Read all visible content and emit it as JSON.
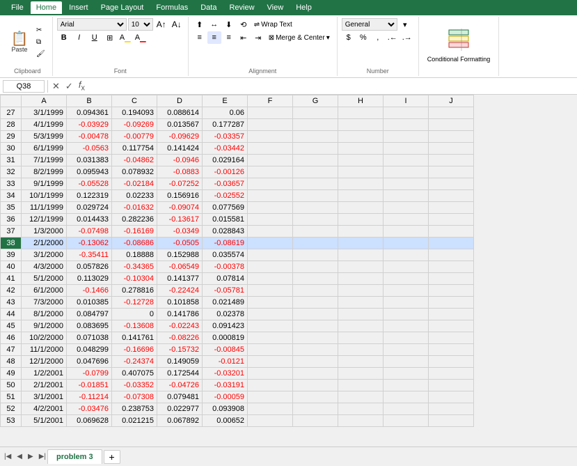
{
  "ribbon": {
    "tabs": [
      "File",
      "Home",
      "Insert",
      "Page Layout",
      "Formulas",
      "Data",
      "Review",
      "View",
      "Help"
    ],
    "active_tab": "Home",
    "groups": {
      "clipboard": {
        "label": "Clipboard",
        "paste_label": "Paste"
      },
      "font": {
        "label": "Font",
        "font_name": "Arial",
        "font_size": "10",
        "bold": "B",
        "italic": "I",
        "underline": "U"
      },
      "alignment": {
        "label": "Alignment",
        "wrap_text": "Wrap Text",
        "merge_center": "Merge & Center"
      },
      "number": {
        "label": "Number",
        "format": "General"
      },
      "conditional": {
        "label": "Conditional Formatting",
        "icon": "▤"
      }
    }
  },
  "formula_bar": {
    "cell_ref": "Q38",
    "formula": ""
  },
  "columns": [
    "",
    "A",
    "B",
    "C",
    "D",
    "E",
    "F",
    "G",
    "H",
    "I",
    "J"
  ],
  "rows": [
    {
      "num": 27,
      "a": "3/1/1999",
      "b": "0.094361",
      "c": "0.194093",
      "d": "0.088614",
      "e": "0.06"
    },
    {
      "num": 28,
      "a": "4/1/1999",
      "b": "-0.03929",
      "c": "-0.09269",
      "d": "0.013567",
      "e": "0.177287"
    },
    {
      "num": 29,
      "a": "5/3/1999",
      "b": "-0.00478",
      "c": "-0.00779",
      "d": "-0.09629",
      "e": "-0.03357"
    },
    {
      "num": 30,
      "a": "6/1/1999",
      "b": "-0.0563",
      "c": "0.117754",
      "d": "0.141424",
      "e": "-0.03442"
    },
    {
      "num": 31,
      "a": "7/1/1999",
      "b": "0.031383",
      "c": "-0.04862",
      "d": "-0.0946",
      "e": "0.029164"
    },
    {
      "num": 32,
      "a": "8/2/1999",
      "b": "0.095943",
      "c": "0.078932",
      "d": "-0.0883",
      "e": "-0.00126"
    },
    {
      "num": 33,
      "a": "9/1/1999",
      "b": "-0.05528",
      "c": "-0.02184",
      "d": "-0.07252",
      "e": "-0.03657"
    },
    {
      "num": 34,
      "a": "10/1/1999",
      "b": "0.122319",
      "c": "0.02233",
      "d": "0.156916",
      "e": "-0.02552"
    },
    {
      "num": 35,
      "a": "11/1/1999",
      "b": "0.029724",
      "c": "-0.01632",
      "d": "-0.09074",
      "e": "0.077569"
    },
    {
      "num": 36,
      "a": "12/1/1999",
      "b": "0.014433",
      "c": "0.282236",
      "d": "-0.13617",
      "e": "0.015581"
    },
    {
      "num": 37,
      "a": "1/3/2000",
      "b": "-0.07498",
      "c": "-0.16169",
      "d": "-0.0349",
      "e": "0.028843"
    },
    {
      "num": 38,
      "a": "2/1/2000",
      "b": "-0.13062",
      "c": "-0.08686",
      "d": "-0.0505",
      "e": "-0.08619",
      "selected": true
    },
    {
      "num": 39,
      "a": "3/1/2000",
      "b": "-0.35411",
      "c": "0.18888",
      "d": "0.152988",
      "e": "0.035574"
    },
    {
      "num": 40,
      "a": "4/3/2000",
      "b": "0.057826",
      "c": "-0.34365",
      "d": "-0.06549",
      "e": "-0.00378"
    },
    {
      "num": 41,
      "a": "5/1/2000",
      "b": "0.113029",
      "c": "-0.10304",
      "d": "0.141377",
      "e": "0.07814"
    },
    {
      "num": 42,
      "a": "6/1/2000",
      "b": "-0.1466",
      "c": "0.278816",
      "d": "-0.22424",
      "e": "-0.05781"
    },
    {
      "num": 43,
      "a": "7/3/2000",
      "b": "0.010385",
      "c": "-0.12728",
      "d": "0.101858",
      "e": "0.021489"
    },
    {
      "num": 44,
      "a": "8/1/2000",
      "b": "0.084797",
      "c": "0",
      "d": "0.141786",
      "e": "0.02378"
    },
    {
      "num": 45,
      "a": "9/1/2000",
      "b": "0.083695",
      "c": "-0.13608",
      "d": "-0.02243",
      "e": "0.091423"
    },
    {
      "num": 46,
      "a": "10/2/2000",
      "b": "0.071038",
      "c": "0.141761",
      "d": "-0.08226",
      "e": "0.000819"
    },
    {
      "num": 47,
      "a": "11/1/2000",
      "b": "0.048299",
      "c": "-0.16696",
      "d": "-0.15732",
      "e": "-0.00845"
    },
    {
      "num": 48,
      "a": "12/1/2000",
      "b": "0.047696",
      "c": "-0.24374",
      "d": "0.149059",
      "e": "-0.0121"
    },
    {
      "num": 49,
      "a": "1/2/2001",
      "b": "-0.0799",
      "c": "0.407075",
      "d": "0.172544",
      "e": "-0.03201"
    },
    {
      "num": 50,
      "a": "2/1/2001",
      "b": "-0.01851",
      "c": "-0.03352",
      "d": "-0.04726",
      "e": "-0.03191"
    },
    {
      "num": 51,
      "a": "3/1/2001",
      "b": "-0.11214",
      "c": "-0.07308",
      "d": "0.079481",
      "e": "-0.00059"
    },
    {
      "num": 52,
      "a": "4/2/2001",
      "b": "-0.03476",
      "c": "0.238753",
      "d": "0.022977",
      "e": "0.093908"
    },
    {
      "num": 53,
      "a": "5/1/2001",
      "b": "0.069628",
      "c": "0.021215",
      "d": "0.067892",
      "e": "0.00652"
    }
  ],
  "sheet_tabs": [
    "problem 3"
  ],
  "active_sheet": "problem 3"
}
